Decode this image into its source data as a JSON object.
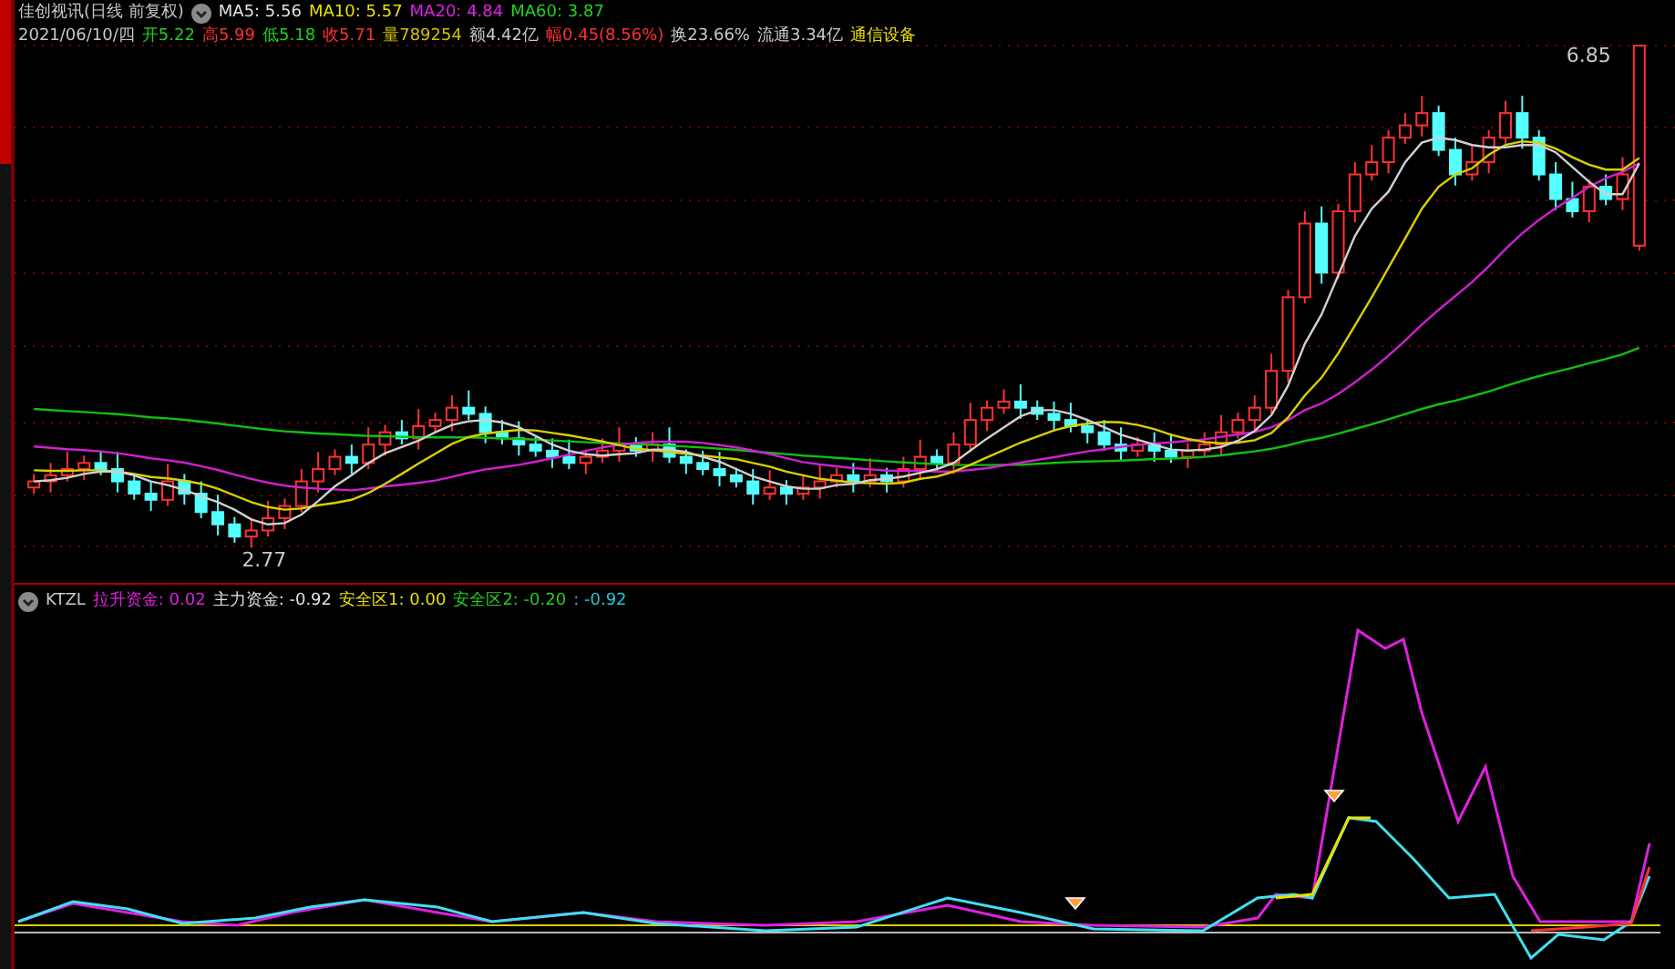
{
  "header": {
    "title": "佳创视讯(日线 前复权)",
    "moving_averages": [
      {
        "text": "MA5: 5.56",
        "color": "#e0e0e0"
      },
      {
        "text": "MA10: 5.57",
        "color": "#e8e000"
      },
      {
        "text": "MA20: 4.84",
        "color": "#e020e0"
      },
      {
        "text": "MA60: 3.87",
        "color": "#20d020"
      }
    ]
  },
  "quote": [
    {
      "text": "2021/06/10/四",
      "color": "#c8c8c8"
    },
    {
      "text": "开5.22",
      "color": "#20d020"
    },
    {
      "text": "高5.99",
      "color": "#ff3030"
    },
    {
      "text": "低5.18",
      "color": "#20d020"
    },
    {
      "text": "收5.71",
      "color": "#ff3030"
    },
    {
      "text": "量789254",
      "color": "#d0c000"
    },
    {
      "text": "额4.42亿",
      "color": "#c8c8c8"
    },
    {
      "text": "幅0.45(8.56%)",
      "color": "#ff3030"
    },
    {
      "text": "换23.66%",
      "color": "#c8c8c8"
    },
    {
      "text": "流通3.34亿",
      "color": "#c8c8c8"
    },
    {
      "text": "通信设备",
      "color": "#e8e000"
    }
  ],
  "price_chart": {
    "high_label": "6.85",
    "low_label": "2.77"
  },
  "indicator": {
    "name": "KTZL",
    "values": [
      {
        "text": "拉升资金: 0.02",
        "color": "#e020e0"
      },
      {
        "text": "主力资金: -0.92",
        "color": "#e0e0e0"
      },
      {
        "text": "安全区1: 0.00",
        "color": "#e8e000"
      },
      {
        "text": "安全区2: -0.20",
        "color": "#20d020"
      },
      {
        "text": ": -0.92",
        "color": "#20c8d8"
      }
    ]
  }
}
